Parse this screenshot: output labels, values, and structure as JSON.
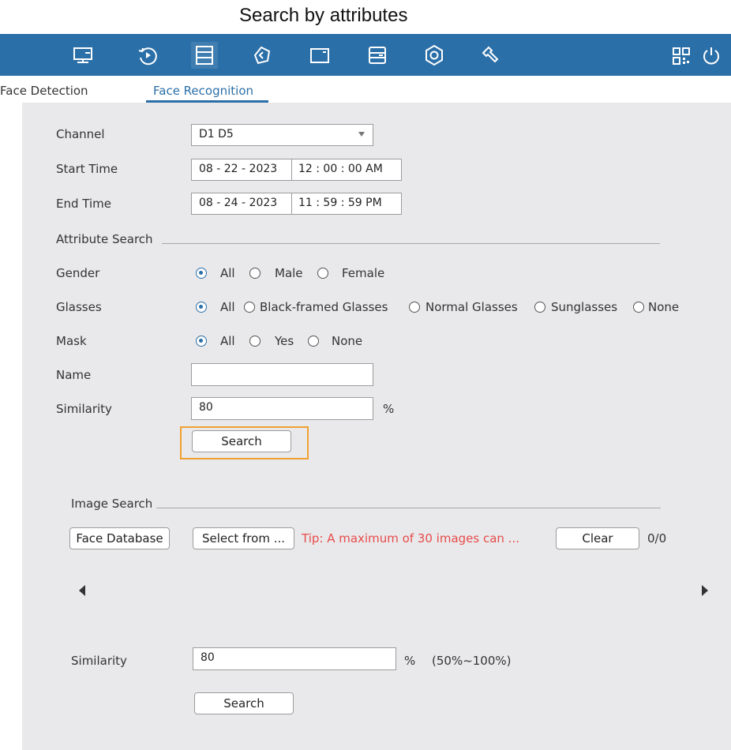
{
  "caption": "Search by attributes",
  "toolbar": {
    "icons": [
      "monitor-icon",
      "playback-icon",
      "file-icon",
      "ai-icon",
      "camera-icon",
      "storage-icon",
      "settings-icon",
      "maintenance-icon"
    ],
    "right_icons": [
      "qr-code-icon",
      "power-icon"
    ],
    "color": "#2b6fa8"
  },
  "tabs": [
    {
      "label": "Face Detection",
      "active": false
    },
    {
      "label": "Face Recognition",
      "active": true
    }
  ],
  "form": {
    "channel_label": "Channel",
    "channel_value": "D1 D5",
    "start_label": "Start Time",
    "start_date": "08 - 22 - 2023",
    "start_time": "12 : 00 : 00 AM",
    "end_label": "End Time",
    "end_date": "08 - 24 - 2023",
    "end_time": "11 : 59 : 59 PM",
    "attribute_section": "Attribute Search",
    "gender_label": "Gender",
    "gender_options": [
      "All",
      "Male",
      "Female"
    ],
    "glasses_label": "Glasses",
    "glasses_options": [
      "All",
      "Black-framed Glasses",
      "Normal Glasses",
      "Sunglasses",
      "None"
    ],
    "mask_label": "Mask",
    "mask_options": [
      "All",
      "Yes",
      "None"
    ],
    "name_label": "Name",
    "name_value": "",
    "similarity_label": "Similarity",
    "similarity_value": "80",
    "percent": "%",
    "search_label": "Search"
  },
  "image_search": {
    "section": "Image Search",
    "face_db_label": "Face Database",
    "select_label": "Select from ...",
    "tip": "Tip: A maximum of 30 images can ...",
    "clear_label": "Clear",
    "count": "0/0",
    "similarity_label": "Similarity",
    "similarity_value": "80",
    "percent": "%",
    "range": "(50%~100%)",
    "search_label": "Search"
  },
  "highlight_color": "#f0a030",
  "tip_color": "#e84b4b"
}
